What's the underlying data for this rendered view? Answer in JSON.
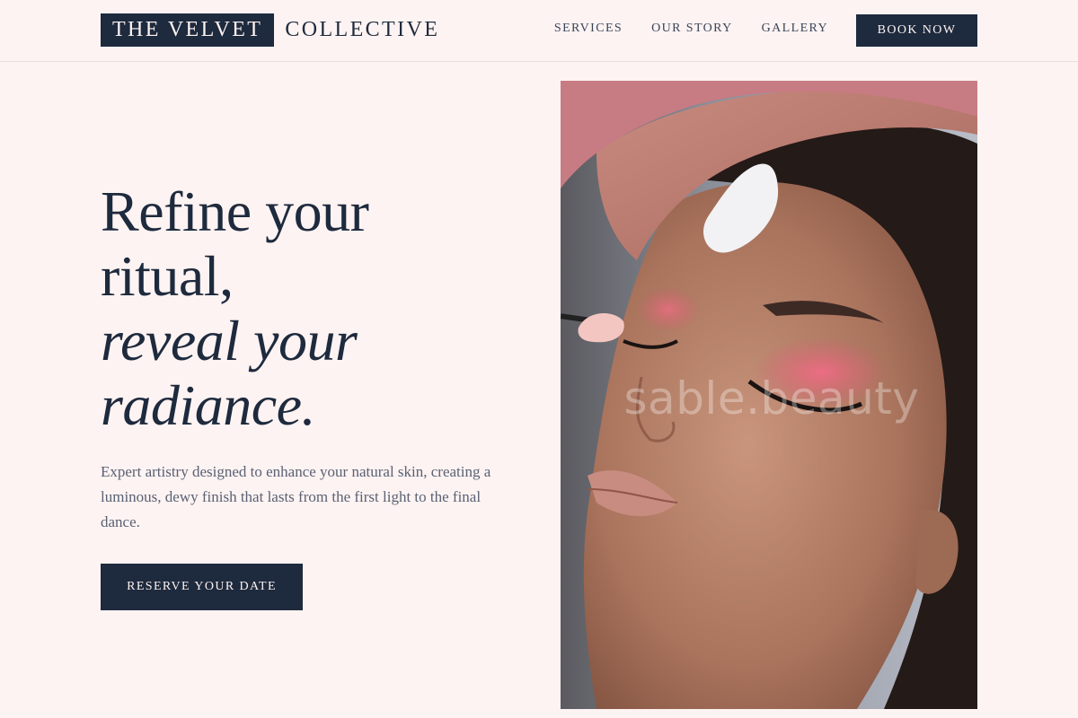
{
  "brand": {
    "name_boxed": "THE VELVET",
    "name_rest": "COLLECTIVE"
  },
  "nav": {
    "items": [
      {
        "label": "SERVICES"
      },
      {
        "label": "OUR STORY"
      },
      {
        "label": "GALLERY"
      }
    ],
    "book_label": "BOOK NOW"
  },
  "hero": {
    "title_lines": [
      "Refine your",
      "ritual,",
      "reveal your",
      "radiance."
    ],
    "description": "Expert artistry designed to enhance your natural skin, creating a luminous, dewy finish that lasts from the first light to the final dance.",
    "cta_label": "RESERVE YOUR DATE",
    "image": {
      "subject": "makeup-application-photo",
      "watermark": "sable.beauty"
    }
  },
  "colors": {
    "background": "#fdf3f2",
    "navy": "#1e2a3d",
    "body_text": "#5a6173",
    "eyeshadow": "#e06b7f"
  }
}
